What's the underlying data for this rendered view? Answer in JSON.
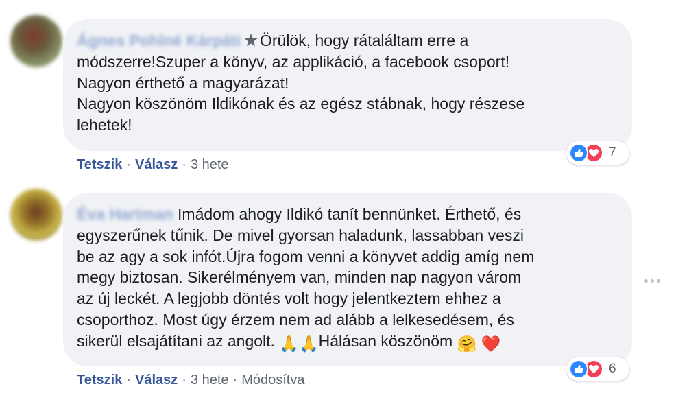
{
  "comments": [
    {
      "author": "Ágnes Pohlné Kárpáti",
      "body_lines": [
        "Örülök, hogy rátaláltam erre a",
        "módszerre!Szuper a könyv, az applikáció, a facebook csoport!",
        "Nagyon érthető a magyarázat!",
        "Nagyon köszönöm Ildikónak és az egész stábnak, hogy részese",
        "lehetek!"
      ],
      "actions": {
        "like": "Tetszik",
        "reply": "Válasz",
        "time": "3 hete"
      },
      "reaction_count": "7"
    },
    {
      "author": "Éva Hartman",
      "body_lines": [
        "Imádom ahogy Ildikó tanít bennünket. Érthető, és",
        "egyszerűnek tűnik. De mivel gyorsan haladunk, lassabban veszi",
        "be az agy a sok infót.Újra fogom venni a könyvet addig amíg nem",
        "megy biztosan. Sikerélményem van, minden nap nagyon várom",
        "az új leckét. A legjobb döntés volt hogy jelentkeztem ehhez a",
        "csoporthoz. Most úgy érzem nem ad alább a lelkesedésem, és",
        "sikerül elsajátítani az angolt.",
        "Hálásan köszönöm"
      ],
      "emojis": {
        "pray1": "🙏",
        "pray2": "🙏",
        "hug": "🤗",
        "heart": "❤️"
      },
      "actions": {
        "like": "Tetszik",
        "reply": "Válasz",
        "time": "3 hete",
        "edited": "Módosítva"
      },
      "reaction_count": "6"
    }
  ],
  "separator": "·",
  "colors": {
    "bubble": "#f0f2f5",
    "link": "#385898",
    "like": "#2d88ff",
    "love": "#f33e58"
  }
}
